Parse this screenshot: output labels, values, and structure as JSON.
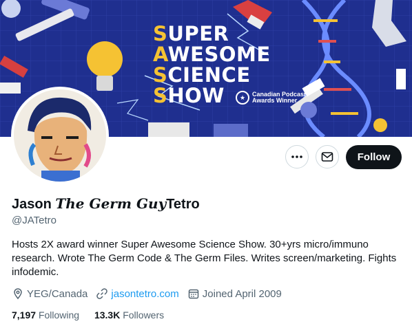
{
  "banner": {
    "title_lines": [
      {
        "first": "S",
        "rest": "UPER"
      },
      {
        "first": "A",
        "rest": "WESOME"
      },
      {
        "first": "S",
        "rest": "CIENCE"
      },
      {
        "first": "S",
        "rest": "HOW"
      }
    ],
    "award_line1": "Canadian Podcast",
    "award_line2": "Awards Winner"
  },
  "actions": {
    "more_icon": "more-dots-icon",
    "message_icon": "mail-icon",
    "follow_label": "Follow"
  },
  "profile": {
    "name_first": "Jason",
    "name_middle": "The Germ Guy",
    "name_last": "Tetro",
    "handle": "@JATetro",
    "bio": "Hosts 2X award winner Super Awesome Science Show. 30+yrs micro/immuno research. Wrote The Germ Code & The Germ Files. Writes screen/marketing. Fights infodemic.",
    "location": "YEG/Canada",
    "website": "jasontetro.com",
    "joined": "Joined April 2009"
  },
  "stats": {
    "following_count": "7,197",
    "following_label": "Following",
    "followers_count": "13.3K",
    "followers_label": "Followers"
  },
  "colors": {
    "accent": "#1d9bf0",
    "follow_bg": "#0f1419",
    "banner_bg": "#1f2f8f",
    "banner_yellow": "#f5c233"
  }
}
